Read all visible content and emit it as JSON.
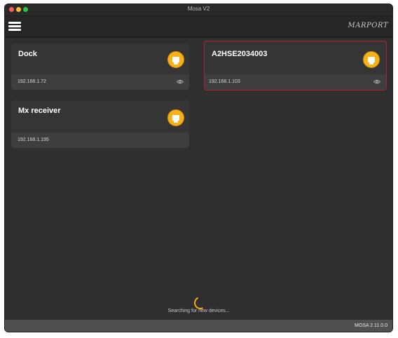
{
  "window": {
    "title": "Mosa V2"
  },
  "toolbar": {
    "menu_icon": "hamburger-menu-icon",
    "logo_text": "MARPORT"
  },
  "colors": {
    "accent": "#f5b118",
    "selected_border": "#b51f27",
    "background": "#2f2f2f"
  },
  "devices": [
    {
      "name": "Dock",
      "ip": "192.168.1.72",
      "icon": "ethernet-icon",
      "has_view": true,
      "selected": false
    },
    {
      "name": "A2HSE2034003",
      "ip": "192.168.1.103",
      "icon": "ethernet-icon",
      "has_view": true,
      "selected": true
    },
    {
      "name": "Mx receiver",
      "ip": "192.168.1.195",
      "icon": "ethernet-icon",
      "has_view": false,
      "selected": false
    }
  ],
  "status": {
    "searching_text": "Searching for new devices..."
  },
  "footer": {
    "version": "MOSA 2.11.0.0"
  }
}
